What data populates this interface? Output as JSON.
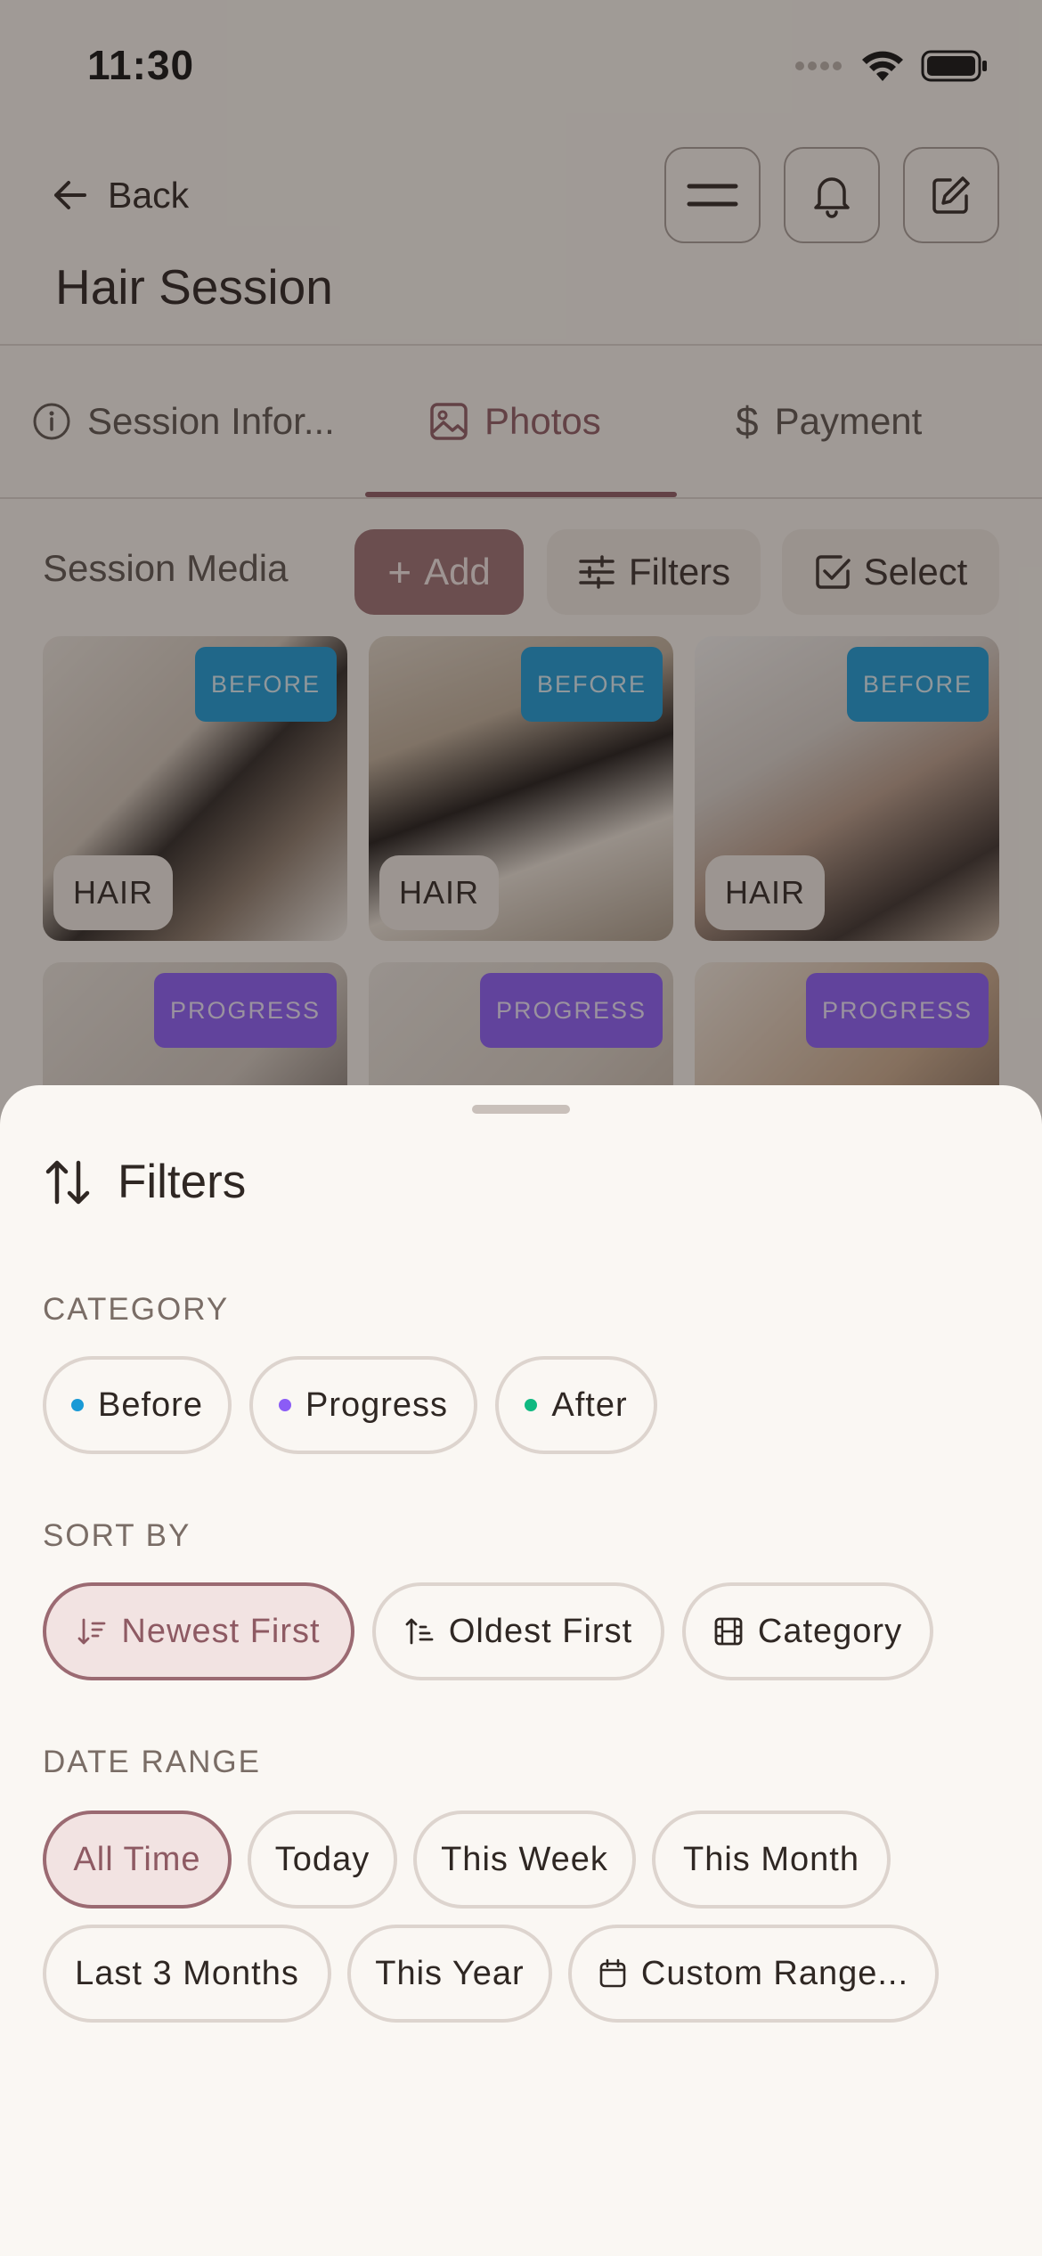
{
  "status_bar": {
    "time": "11:30"
  },
  "header": {
    "back_label": "Back",
    "title": "Hair Session"
  },
  "tabs": [
    {
      "label": "Session Infor..."
    },
    {
      "label": "Photos"
    },
    {
      "label": "Payment"
    }
  ],
  "toolbar": {
    "section_label": "Session Media",
    "add_label": "Add",
    "filters_label": "Filters",
    "select_label": "Select"
  },
  "photos": [
    {
      "category": "BEFORE",
      "service": "HAIR"
    },
    {
      "category": "BEFORE",
      "service": "HAIR"
    },
    {
      "category": "BEFORE",
      "service": "HAIR"
    },
    {
      "category": "PROGRESS",
      "service": ""
    },
    {
      "category": "PROGRESS",
      "service": ""
    },
    {
      "category": "PROGRESS",
      "service": ""
    }
  ],
  "sheet": {
    "title": "Filters",
    "category": {
      "label": "CATEGORY",
      "options": [
        "Before",
        "Progress",
        "After"
      ]
    },
    "sort": {
      "label": "SORT BY",
      "options": [
        "Newest First",
        "Oldest First",
        "Category"
      ],
      "selected": "Newest First"
    },
    "date_range": {
      "label": "DATE RANGE",
      "options": [
        "All Time",
        "Today",
        "This Week",
        "This Month",
        "Last 3 Months",
        "This Year",
        "Custom Range..."
      ],
      "selected": "All Time"
    }
  },
  "colors": {
    "accent": "#8e5a63",
    "before": "#1a9ad6",
    "progress": "#8b5cf6",
    "after": "#10b981"
  }
}
